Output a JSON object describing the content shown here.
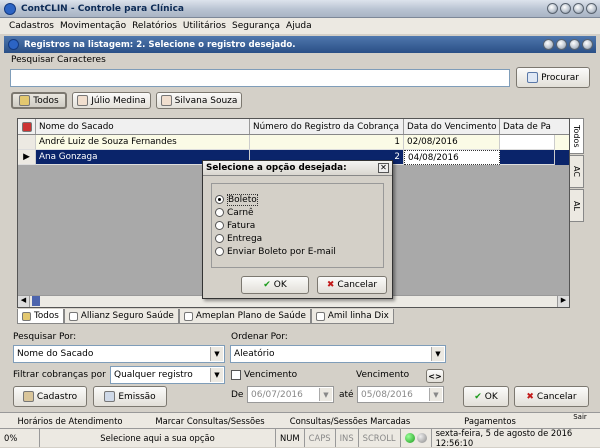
{
  "window": {
    "title": "ContCLIN - Controle para Clínica"
  },
  "menu": [
    "Cadastros",
    "Movimentação",
    "Relatórios",
    "Utilitários",
    "Segurança",
    "Ajuda"
  ],
  "child": {
    "title": "Registros na listagem: 2. Selecione o registro desejado."
  },
  "search": {
    "label": "Pesquisar Caracteres",
    "value": "",
    "button": "Procurar"
  },
  "filter_tabs": [
    "Todos",
    "Júlio Medina",
    "Silvana Souza"
  ],
  "grid": {
    "columns": [
      "Nome do Sacado",
      "Número do Registro da Cobrança",
      "Data do Vencimento",
      "Data de Pa"
    ],
    "rows": [
      {
        "name": "André Luiz de Souza Fernandes",
        "num": "1",
        "date": "02/08/2016"
      },
      {
        "name": "Ana Gonzaga",
        "num": "2",
        "date": "04/08/2016"
      }
    ]
  },
  "side_tabs": [
    "Todos",
    "AC",
    "AL"
  ],
  "bottom_tabs": [
    "Todos",
    "Allianz Seguro Saúde",
    "Ameplan Plano de Saúde",
    "Amil linha Dix"
  ],
  "dialog": {
    "title": "Selecione a opção desejada:",
    "options": [
      "Boleto",
      "Carnê",
      "Fatura",
      "Entrega",
      "Enviar Boleto por E-mail"
    ],
    "selected": "Boleto",
    "ok": "OK",
    "cancel": "Cancelar"
  },
  "form": {
    "pesquisar_label": "Pesquisar Por:",
    "pesquisar_value": "Nome do Sacado",
    "ordenar_label": "Ordenar Por:",
    "ordenar_value": "Aleatório",
    "filtrar_label": "Filtrar cobranças por",
    "filtrar_value": "Qualquer registro",
    "venc_check": "Vencimento",
    "venc_label": "Vencimento",
    "de_label": "De",
    "de_value": "06/07/2016",
    "ate_label": "até",
    "ate_value": "05/08/2016",
    "arrow_btn": "<>",
    "cadastro": "Cadastro",
    "emissao": "Emissão",
    "ok": "OK",
    "cancelar": "Cancelar"
  },
  "bottombar": [
    "Horários de Atendimento",
    "Marcar Consultas/Sessões",
    "Consultas/Sessões Marcadas",
    "Pagamentos"
  ],
  "sair": "Sair",
  "status": {
    "percent": "0%",
    "message": "Selecione aqui a sua opção",
    "num": "NUM",
    "caps": "CAPS",
    "ins": "INS",
    "scroll": "SCROLL",
    "datetime": "sexta-feira, 5 de agosto de 2016 12:56:10"
  },
  "colors": {
    "accent": "#0a246a",
    "title_blue": "#2a4f86",
    "selection": "#0a246a"
  }
}
